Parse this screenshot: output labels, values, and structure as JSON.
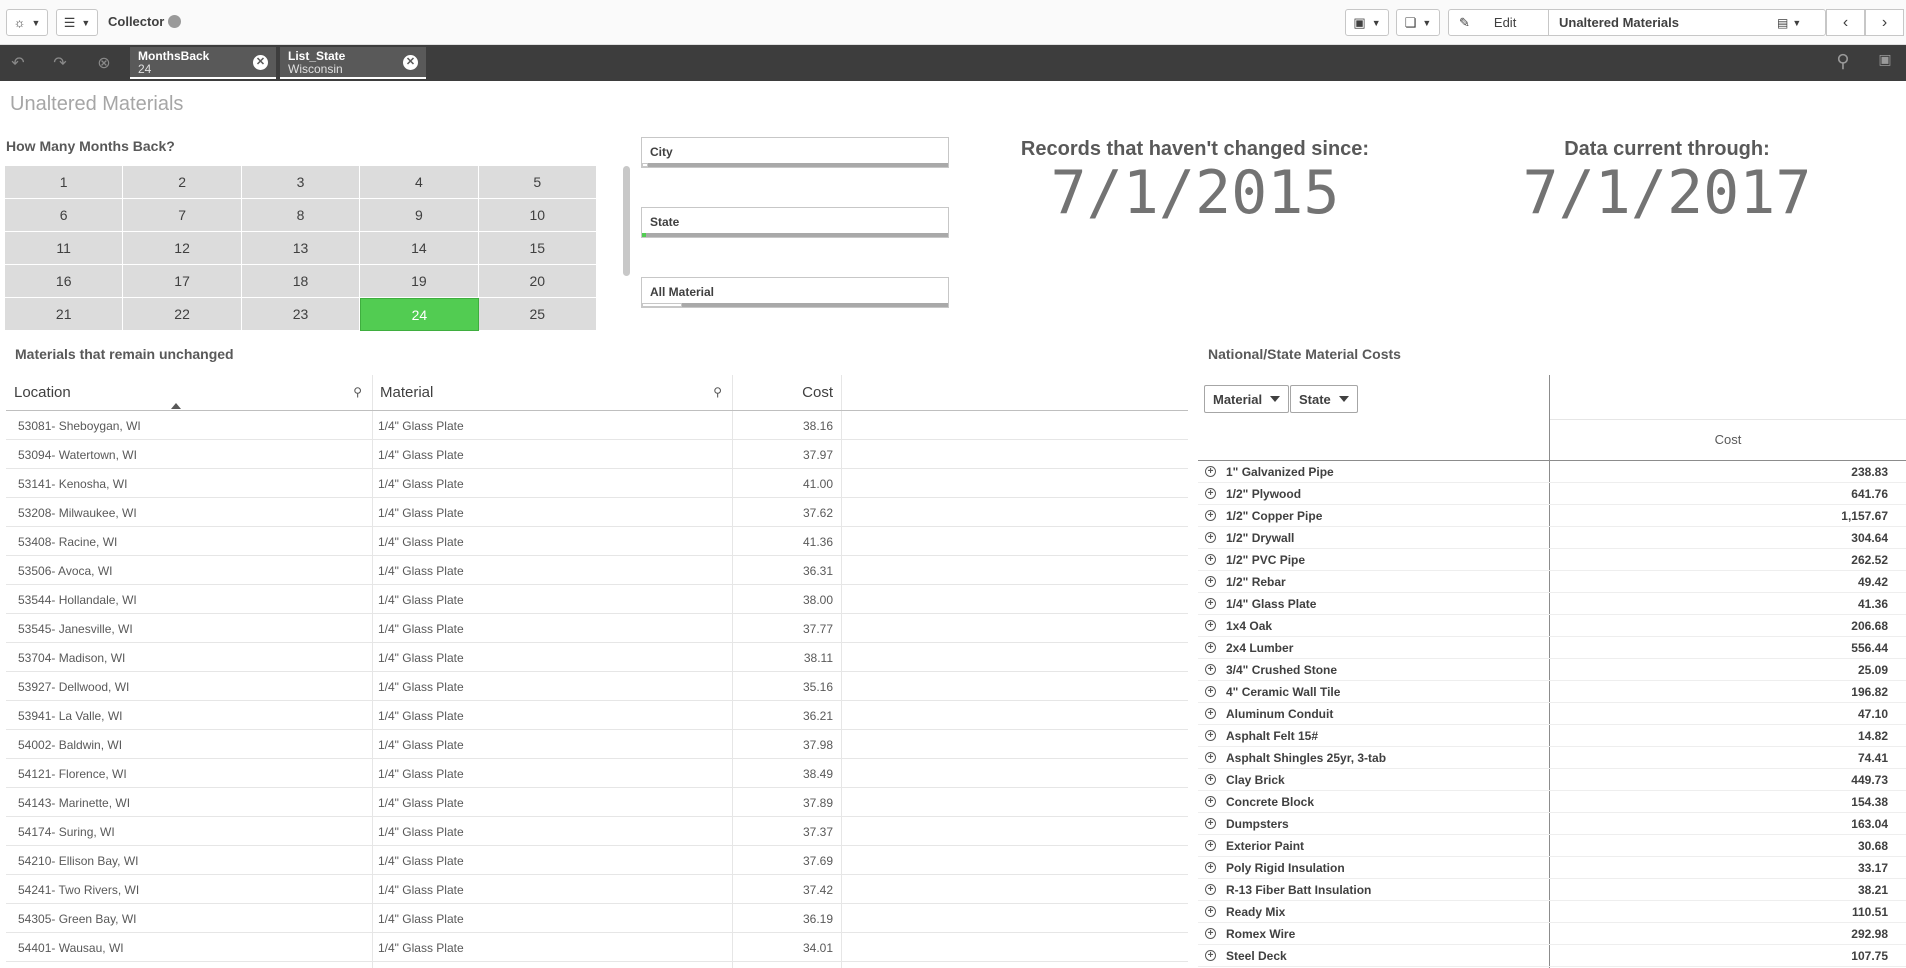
{
  "toolbar": {
    "app_title": "Collector",
    "edit_label": "Edit",
    "sheet_name": "Unaltered Materials"
  },
  "selections": [
    {
      "field": "MonthsBack",
      "value": "24"
    },
    {
      "field": "List_State",
      "value": "Wisconsin"
    }
  ],
  "page_title": "Unaltered Materials",
  "months": {
    "title": "How Many Months Back?",
    "values": [
      "1",
      "2",
      "3",
      "4",
      "5",
      "6",
      "7",
      "8",
      "9",
      "10",
      "11",
      "12",
      "13",
      "14",
      "15",
      "16",
      "17",
      "18",
      "19",
      "20",
      "21",
      "22",
      "23",
      "24",
      "25"
    ],
    "selected": "24",
    "selected_color": "#52cc52"
  },
  "filters": {
    "city": "City",
    "state": "State",
    "material": "All Material"
  },
  "kpis": {
    "since_label": "Records that haven't changed since:",
    "since_value": "7/1/2015",
    "current_label": "Data current through:",
    "current_value": "7/1/2017"
  },
  "left_table": {
    "title": "Materials that remain unchanged",
    "headers": {
      "location": "Location",
      "material": "Material",
      "cost": "Cost"
    },
    "rows": [
      [
        "53081- Sheboygan, WI",
        "1/4\" Glass Plate",
        "38.16"
      ],
      [
        "53094- Watertown, WI",
        "1/4\" Glass Plate",
        "37.97"
      ],
      [
        "53141- Kenosha, WI",
        "1/4\" Glass Plate",
        "41.00"
      ],
      [
        "53208- Milwaukee, WI",
        "1/4\" Glass Plate",
        "37.62"
      ],
      [
        "53408- Racine, WI",
        "1/4\" Glass Plate",
        "41.36"
      ],
      [
        "53506- Avoca, WI",
        "1/4\" Glass Plate",
        "36.31"
      ],
      [
        "53544- Hollandale, WI",
        "1/4\" Glass Plate",
        "38.00"
      ],
      [
        "53545- Janesville, WI",
        "1/4\" Glass Plate",
        "37.77"
      ],
      [
        "53704- Madison, WI",
        "1/4\" Glass Plate",
        "38.11"
      ],
      [
        "53927- Dellwood, WI",
        "1/4\" Glass Plate",
        "35.16"
      ],
      [
        "53941- La Valle, WI",
        "1/4\" Glass Plate",
        "36.21"
      ],
      [
        "54002- Baldwin, WI",
        "1/4\" Glass Plate",
        "37.98"
      ],
      [
        "54121- Florence, WI",
        "1/4\" Glass Plate",
        "38.49"
      ],
      [
        "54143- Marinette, WI",
        "1/4\" Glass Plate",
        "37.89"
      ],
      [
        "54174- Suring, WI",
        "1/4\" Glass Plate",
        "37.37"
      ],
      [
        "54210- Ellison Bay, WI",
        "1/4\" Glass Plate",
        "37.69"
      ],
      [
        "54241- Two Rivers, WI",
        "1/4\" Glass Plate",
        "37.42"
      ],
      [
        "54305- Green Bay, WI",
        "1/4\" Glass Plate",
        "36.19"
      ],
      [
        "54401- Wausau, WI",
        "1/4\" Glass Plate",
        "34.01"
      ]
    ]
  },
  "right_table": {
    "title": "National/State Material Costs",
    "dim1": "Material",
    "dim2": "State",
    "measure": "Cost",
    "rows": [
      [
        "1\" Galvanized Pipe",
        "238.83"
      ],
      [
        "1/2\" Plywood",
        "641.76"
      ],
      [
        "1/2\" Copper Pipe",
        "1,157.67"
      ],
      [
        "1/2\" Drywall",
        "304.64"
      ],
      [
        "1/2\" PVC Pipe",
        "262.52"
      ],
      [
        "1/2\" Rebar",
        "49.42"
      ],
      [
        "1/4\" Glass Plate",
        "41.36"
      ],
      [
        "1x4 Oak",
        "206.68"
      ],
      [
        "2x4 Lumber",
        "556.44"
      ],
      [
        "3/4\" Crushed Stone",
        "25.09"
      ],
      [
        "4\" Ceramic Wall Tile",
        "196.82"
      ],
      [
        "Aluminum Conduit",
        "47.10"
      ],
      [
        "Asphalt Felt 15#",
        "14.82"
      ],
      [
        "Asphalt Shingles 25yr, 3-tab",
        "74.41"
      ],
      [
        "Clay Brick",
        "449.73"
      ],
      [
        "Concrete Block",
        "154.38"
      ],
      [
        "Dumpsters",
        "163.04"
      ],
      [
        "Exterior Paint",
        "30.68"
      ],
      [
        "Poly Rigid Insulation",
        "33.17"
      ],
      [
        "R-13 Fiber Batt Insulation",
        "38.21"
      ],
      [
        "Ready Mix",
        "110.51"
      ],
      [
        "Romex Wire",
        "292.98"
      ],
      [
        "Steel Deck",
        "107.75"
      ]
    ]
  }
}
